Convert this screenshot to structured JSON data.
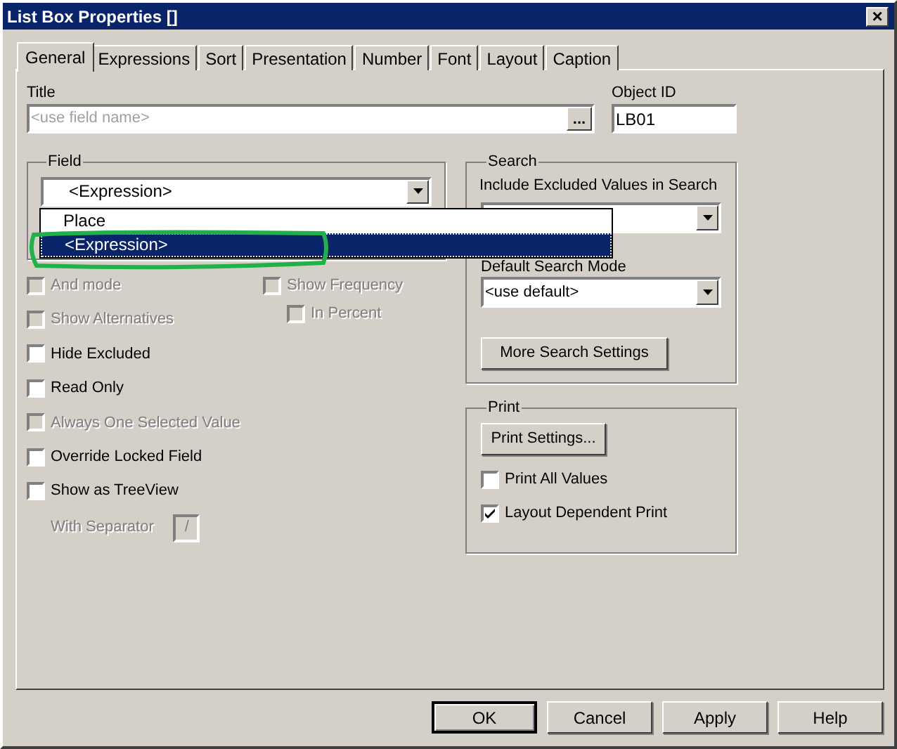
{
  "window": {
    "title": "List Box Properties []",
    "close": "×"
  },
  "tabs": [
    {
      "label": "General",
      "selected": true
    },
    {
      "label": "Expressions",
      "selected": false
    },
    {
      "label": "Sort",
      "selected": false
    },
    {
      "label": "Presentation",
      "selected": false
    },
    {
      "label": "Number",
      "selected": false
    },
    {
      "label": "Font",
      "selected": false
    },
    {
      "label": "Layout",
      "selected": false
    },
    {
      "label": "Caption",
      "selected": false
    }
  ],
  "title_field": {
    "label": "Title",
    "placeholder": "<use field name>",
    "button": "..."
  },
  "object_id": {
    "label": "Object ID",
    "value": "LB01"
  },
  "field": {
    "legend": "Field",
    "value": "<Expression>",
    "dropdown": [
      {
        "label": "Place",
        "selected": false
      },
      {
        "label": "<Expression>",
        "selected": true
      }
    ]
  },
  "options": [
    {
      "label": "And mode",
      "checked": false,
      "disabled": true
    },
    {
      "label": "Show Alternatives",
      "checked": false,
      "disabled": true
    },
    {
      "label": "Hide Excluded",
      "checked": false,
      "disabled": false
    },
    {
      "label": "Read Only",
      "checked": false,
      "disabled": false
    },
    {
      "label": "Always One Selected Value",
      "checked": false,
      "disabled": true
    },
    {
      "label": "Override Locked Field",
      "checked": false,
      "disabled": false
    },
    {
      "label": "Show as TreeView",
      "checked": false,
      "disabled": false
    }
  ],
  "frequency_options": [
    {
      "label": "Show Frequency",
      "checked": false,
      "disabled": true
    },
    {
      "label": "In Percent",
      "checked": false,
      "disabled": true
    }
  ],
  "separator": {
    "label": "With Separator",
    "value": "/",
    "disabled": true
  },
  "search": {
    "legend": "Search",
    "excluded_label": "Include Excluded Values in Search",
    "mode_label": "Default Search Mode",
    "mode_value": "<use default>",
    "button": "More Search Settings"
  },
  "print": {
    "legend": "Print",
    "button": "Print Settings...",
    "options": [
      {
        "label": "Print All Values",
        "checked": false,
        "disabled": false
      },
      {
        "label": "Layout Dependent Print",
        "checked": true,
        "disabled": false
      }
    ]
  },
  "buttons": [
    {
      "label": "OK",
      "default": true
    },
    {
      "label": "Cancel",
      "default": false
    },
    {
      "label": "Apply",
      "default": false
    },
    {
      "label": "Help",
      "default": false
    }
  ]
}
